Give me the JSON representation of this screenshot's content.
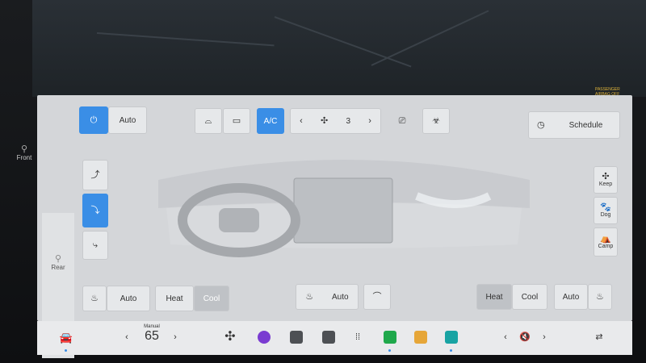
{
  "top": {
    "airbag_line1": "PASSENGER",
    "airbag_line2": "AIRBAG OFF"
  },
  "left_side": {
    "front_label": "Front",
    "rear_label": "Rear"
  },
  "controls": {
    "power_icon": "power-icon",
    "auto_label": "Auto",
    "ac_label": "A/C",
    "fan_speed": "3",
    "schedule_label": "Schedule"
  },
  "right_side": {
    "keep_label": "Keep",
    "dog_label": "Dog",
    "camp_label": "Camp"
  },
  "bottom": {
    "left_seat_auto": "Auto",
    "left_heat": "Heat",
    "left_cool": "Cool",
    "center_auto": "Auto",
    "right_heat": "Heat",
    "right_cool": "Cool",
    "right_seat_auto": "Auto"
  },
  "taskbar": {
    "mode_label": "Manual",
    "temperature": "65"
  },
  "colors": {
    "accent": "#3a8ee6",
    "panel": "#d4d6d9"
  }
}
